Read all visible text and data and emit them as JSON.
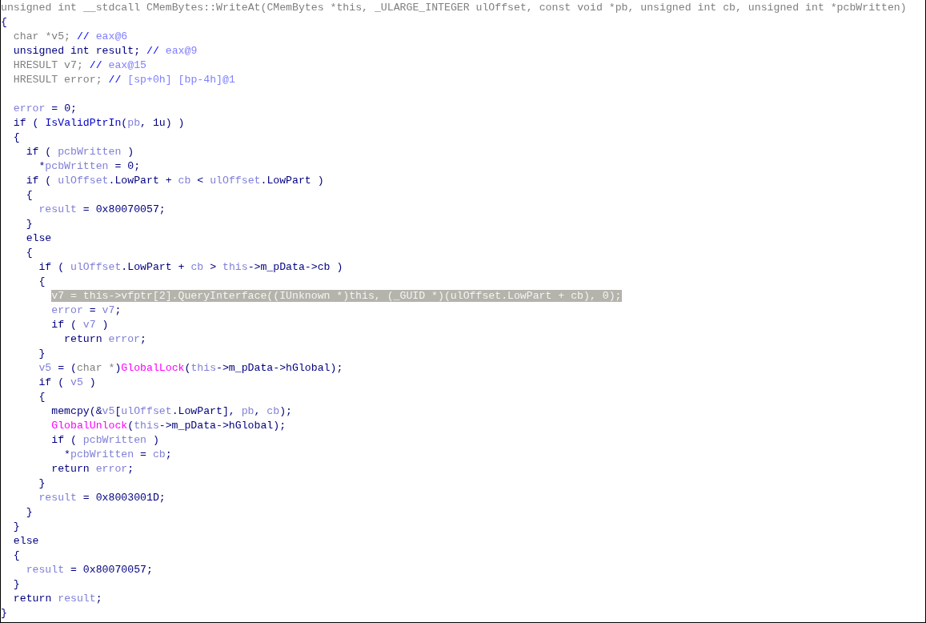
{
  "pseudocode_view": {
    "lines": [
      {
        "kind": "code",
        "tokens": [
          {
            "kind": "gray",
            "text": "unsigned int __stdcall CMemBytes::WriteAt(CMemBytes *this, _ULARGE_INTEGER ulOffset, const void *pb, unsigned int cb, unsigned int *pcbWritten)"
          }
        ]
      },
      {
        "kind": "code",
        "tokens": [
          {
            "kind": "plain",
            "text": "{"
          }
        ],
        "children": [
          {
            "kind": "code",
            "tokens": [
              {
                "kind": "gray",
                "text": "char *v5; "
              },
              {
                "kind": "comment",
                "text": "// "
              },
              {
                "kind": "note",
                "text": "eax@6"
              }
            ]
          },
          {
            "kind": "code",
            "tokens": [
              {
                "kind": "plain",
                "text": "unsigned int result; "
              },
              {
                "kind": "comment",
                "text": "// "
              },
              {
                "kind": "note",
                "text": "eax@9"
              }
            ]
          },
          {
            "kind": "code",
            "tokens": [
              {
                "kind": "gray",
                "text": "HRESULT v7; "
              },
              {
                "kind": "comment",
                "text": "// "
              },
              {
                "kind": "note",
                "text": "eax@15"
              }
            ]
          },
          {
            "kind": "code",
            "tokens": [
              {
                "kind": "gray",
                "text": "HRESULT error; "
              },
              {
                "kind": "comment",
                "text": "// "
              },
              {
                "kind": "note",
                "text": "[sp+0h] [bp-4h]@1"
              }
            ]
          },
          {
            "kind": "blank"
          },
          {
            "kind": "code",
            "tokens": [
              {
                "kind": "var",
                "text": "error"
              },
              {
                "kind": "plain",
                "text": " = 0;"
              }
            ]
          },
          {
            "kind": "code",
            "tokens": [
              {
                "kind": "plain",
                "text": "if ( "
              },
              {
                "kind": "func",
                "text": "IsValidPtrIn"
              },
              {
                "kind": "plain",
                "text": "("
              },
              {
                "kind": "var",
                "text": "pb"
              },
              {
                "kind": "plain",
                "text": ", 1u) )"
              }
            ]
          },
          {
            "kind": "code",
            "tokens": [
              {
                "kind": "plain",
                "text": "{"
              }
            ],
            "children": [
              {
                "kind": "code",
                "tokens": [
                  {
                    "kind": "plain",
                    "text": "if ( "
                  },
                  {
                    "kind": "var",
                    "text": "pcbWritten"
                  },
                  {
                    "kind": "plain",
                    "text": " )"
                  }
                ],
                "children": [
                  {
                    "kind": "code",
                    "tokens": [
                      {
                        "kind": "plain",
                        "text": "*"
                      },
                      {
                        "kind": "var",
                        "text": "pcbWritten"
                      },
                      {
                        "kind": "plain",
                        "text": " = 0;"
                      }
                    ]
                  }
                ]
              },
              {
                "kind": "code",
                "tokens": [
                  {
                    "kind": "plain",
                    "text": "if ( "
                  },
                  {
                    "kind": "var",
                    "text": "ulOffset"
                  },
                  {
                    "kind": "plain",
                    "text": ".LowPart + "
                  },
                  {
                    "kind": "var",
                    "text": "cb"
                  },
                  {
                    "kind": "plain",
                    "text": " < "
                  },
                  {
                    "kind": "var",
                    "text": "ulOffset"
                  },
                  {
                    "kind": "plain",
                    "text": ".LowPart )"
                  }
                ]
              },
              {
                "kind": "code",
                "tokens": [
                  {
                    "kind": "plain",
                    "text": "{"
                  }
                ],
                "children": [
                  {
                    "kind": "code",
                    "tokens": [
                      {
                        "kind": "var",
                        "text": "result"
                      },
                      {
                        "kind": "plain",
                        "text": " = 0x80070057;"
                      }
                    ]
                  }
                ]
              },
              {
                "kind": "code",
                "tokens": [
                  {
                    "kind": "plain",
                    "text": "}"
                  }
                ]
              },
              {
                "kind": "code",
                "tokens": [
                  {
                    "kind": "plain",
                    "text": "else"
                  }
                ]
              },
              {
                "kind": "code",
                "tokens": [
                  {
                    "kind": "plain",
                    "text": "{"
                  }
                ],
                "children": [
                  {
                    "kind": "code",
                    "tokens": [
                      {
                        "kind": "plain",
                        "text": "if ( "
                      },
                      {
                        "kind": "var",
                        "text": "ulOffset"
                      },
                      {
                        "kind": "plain",
                        "text": ".LowPart + "
                      },
                      {
                        "kind": "var",
                        "text": "cb"
                      },
                      {
                        "kind": "plain",
                        "text": " > "
                      },
                      {
                        "kind": "var",
                        "text": "this"
                      },
                      {
                        "kind": "plain",
                        "text": "->m_pData->cb )"
                      }
                    ]
                  },
                  {
                    "kind": "code",
                    "tokens": [
                      {
                        "kind": "plain",
                        "text": "{"
                      }
                    ],
                    "children": [
                      {
                        "kind": "code",
                        "highlighted": true,
                        "tokens": [
                          {
                            "kind": "plain",
                            "text": "v7 = this->vfptr[2].QueryInterface((IUnknown *)this, (_GUID *)(ulOffset.LowPart + cb), 0);"
                          }
                        ]
                      },
                      {
                        "kind": "code",
                        "tokens": [
                          {
                            "kind": "var",
                            "text": "error"
                          },
                          {
                            "kind": "plain",
                            "text": " = "
                          },
                          {
                            "kind": "var",
                            "text": "v7"
                          },
                          {
                            "kind": "plain",
                            "text": ";"
                          }
                        ]
                      },
                      {
                        "kind": "code",
                        "tokens": [
                          {
                            "kind": "plain",
                            "text": "if ( "
                          },
                          {
                            "kind": "var",
                            "text": "v7"
                          },
                          {
                            "kind": "plain",
                            "text": " )"
                          }
                        ],
                        "children": [
                          {
                            "kind": "code",
                            "tokens": [
                              {
                                "kind": "plain",
                                "text": "return "
                              },
                              {
                                "kind": "var",
                                "text": "error"
                              },
                              {
                                "kind": "plain",
                                "text": ";"
                              }
                            ]
                          }
                        ]
                      }
                    ]
                  },
                  {
                    "kind": "code",
                    "tokens": [
                      {
                        "kind": "plain",
                        "text": "}"
                      }
                    ]
                  },
                  {
                    "kind": "code",
                    "tokens": [
                      {
                        "kind": "var",
                        "text": "v5"
                      },
                      {
                        "kind": "plain",
                        "text": " = ("
                      },
                      {
                        "kind": "gray",
                        "text": "char *"
                      },
                      {
                        "kind": "plain",
                        "text": ")"
                      },
                      {
                        "kind": "import",
                        "text": "GlobalLock"
                      },
                      {
                        "kind": "plain",
                        "text": "("
                      },
                      {
                        "kind": "var",
                        "text": "this"
                      },
                      {
                        "kind": "plain",
                        "text": "->m_pData->hGlobal);"
                      }
                    ]
                  },
                  {
                    "kind": "code",
                    "tokens": [
                      {
                        "kind": "plain",
                        "text": "if ( "
                      },
                      {
                        "kind": "var",
                        "text": "v5"
                      },
                      {
                        "kind": "plain",
                        "text": " )"
                      }
                    ]
                  },
                  {
                    "kind": "code",
                    "tokens": [
                      {
                        "kind": "plain",
                        "text": "{"
                      }
                    ],
                    "children": [
                      {
                        "kind": "code",
                        "tokens": [
                          {
                            "kind": "plain",
                            "text": "memcpy(&"
                          },
                          {
                            "kind": "var",
                            "text": "v5"
                          },
                          {
                            "kind": "plain",
                            "text": "["
                          },
                          {
                            "kind": "var",
                            "text": "ulOffset"
                          },
                          {
                            "kind": "plain",
                            "text": ".LowPart], "
                          },
                          {
                            "kind": "var",
                            "text": "pb"
                          },
                          {
                            "kind": "plain",
                            "text": ", "
                          },
                          {
                            "kind": "var",
                            "text": "cb"
                          },
                          {
                            "kind": "plain",
                            "text": ");"
                          }
                        ]
                      },
                      {
                        "kind": "code",
                        "tokens": [
                          {
                            "kind": "import",
                            "text": "GlobalUnlock"
                          },
                          {
                            "kind": "plain",
                            "text": "("
                          },
                          {
                            "kind": "var",
                            "text": "this"
                          },
                          {
                            "kind": "plain",
                            "text": "->m_pData->hGlobal);"
                          }
                        ]
                      },
                      {
                        "kind": "code",
                        "tokens": [
                          {
                            "kind": "plain",
                            "text": "if ( "
                          },
                          {
                            "kind": "var",
                            "text": "pcbWritten"
                          },
                          {
                            "kind": "plain",
                            "text": " )"
                          }
                        ],
                        "children": [
                          {
                            "kind": "code",
                            "tokens": [
                              {
                                "kind": "plain",
                                "text": "*"
                              },
                              {
                                "kind": "var",
                                "text": "pcbWritten"
                              },
                              {
                                "kind": "plain",
                                "text": " = "
                              },
                              {
                                "kind": "var",
                                "text": "cb"
                              },
                              {
                                "kind": "plain",
                                "text": ";"
                              }
                            ]
                          }
                        ]
                      },
                      {
                        "kind": "code",
                        "tokens": [
                          {
                            "kind": "plain",
                            "text": "return "
                          },
                          {
                            "kind": "var",
                            "text": "error"
                          },
                          {
                            "kind": "plain",
                            "text": ";"
                          }
                        ]
                      }
                    ]
                  },
                  {
                    "kind": "code",
                    "tokens": [
                      {
                        "kind": "plain",
                        "text": "}"
                      }
                    ]
                  },
                  {
                    "kind": "code",
                    "tokens": [
                      {
                        "kind": "var",
                        "text": "result"
                      },
                      {
                        "kind": "plain",
                        "text": " = 0x8003001D;"
                      }
                    ]
                  }
                ]
              },
              {
                "kind": "code",
                "tokens": [
                  {
                    "kind": "plain",
                    "text": "}"
                  }
                ]
              }
            ]
          },
          {
            "kind": "code",
            "tokens": [
              {
                "kind": "plain",
                "text": "}"
              }
            ]
          },
          {
            "kind": "code",
            "tokens": [
              {
                "kind": "plain",
                "text": "else"
              }
            ]
          },
          {
            "kind": "code",
            "tokens": [
              {
                "kind": "plain",
                "text": "{"
              }
            ],
            "children": [
              {
                "kind": "code",
                "tokens": [
                  {
                    "kind": "var",
                    "text": "result"
                  },
                  {
                    "kind": "plain",
                    "text": " = 0x80070057;"
                  }
                ]
              }
            ]
          },
          {
            "kind": "code",
            "tokens": [
              {
                "kind": "plain",
                "text": "}"
              }
            ]
          },
          {
            "kind": "code",
            "tokens": [
              {
                "kind": "plain",
                "text": "return "
              },
              {
                "kind": "var",
                "text": "result"
              },
              {
                "kind": "plain",
                "text": ";"
              }
            ]
          }
        ]
      },
      {
        "kind": "code",
        "tokens": [
          {
            "kind": "plain",
            "text": "}"
          }
        ]
      }
    ]
  }
}
